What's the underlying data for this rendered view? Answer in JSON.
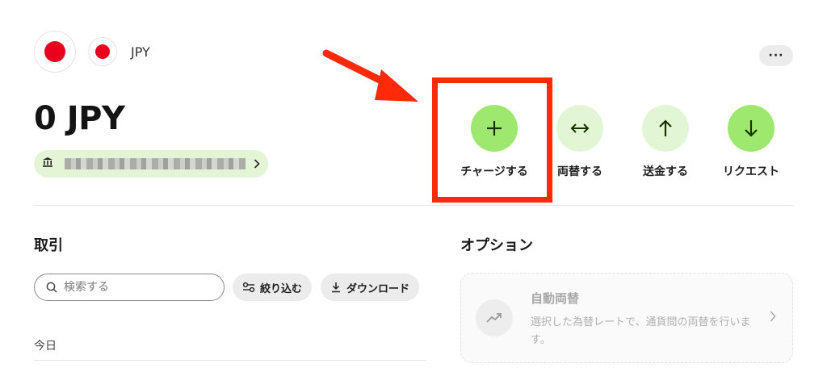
{
  "account": {
    "currency_code": "JPY",
    "balance": "0 JPY",
    "flag_color": "#e8001c",
    "bank_icon": "bank-icon",
    "more_label": "···"
  },
  "actions": [
    {
      "label": "チャージする",
      "icon": "plus-icon"
    },
    {
      "label": "両替する",
      "icon": "swap-arrows-icon"
    },
    {
      "label": "送金する",
      "icon": "arrow-up-icon"
    },
    {
      "label": "リクエスト",
      "icon": "arrow-down-icon"
    }
  ],
  "transactions": {
    "title": "取引",
    "search_placeholder": "検索する",
    "filter_label": "絞り込む",
    "download_label": "ダウンロード",
    "today_label": "今日"
  },
  "options": {
    "title": "オプション",
    "auto_exchange": {
      "title": "自動両替",
      "description": "選択した為替レートで、通貨間の両替を行います。",
      "icon": "trend-up-icon"
    }
  },
  "colors": {
    "accent_green": "#9fe870",
    "soft_green": "#e2f6d5",
    "highlight_red": "#ff2a0a"
  }
}
